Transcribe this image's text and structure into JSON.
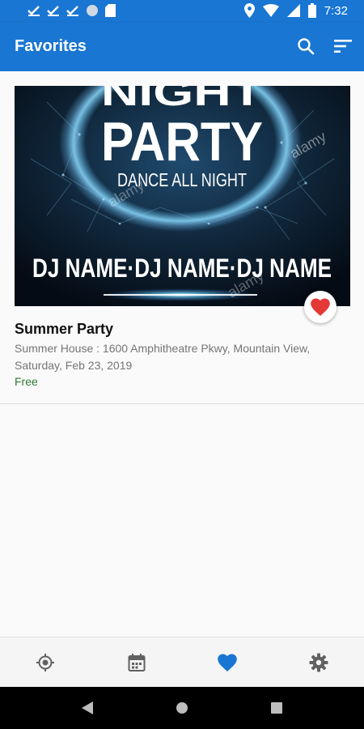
{
  "status_bar": {
    "time": "7:32",
    "icons": [
      "check-icon",
      "check-icon",
      "check-icon",
      "circle-icon",
      "sd-card-icon",
      "location-icon",
      "wifi-icon",
      "signal-icon",
      "battery-icon"
    ]
  },
  "app_bar": {
    "title": "Favorites",
    "actions": [
      "search-icon",
      "sort-icon"
    ]
  },
  "event": {
    "poster": {
      "headline_top": "NIGHT",
      "headline": "PARTY",
      "tagline": "DANCE ALL NIGHT",
      "lineup": "DJ NAME·DJ NAME·DJ NAME",
      "watermark": "alamy"
    },
    "title": "Summer Party",
    "location": "Summer House : 1600 Amphitheatre Pkwy, Mountain View,",
    "date": "Saturday, Feb 23, 2019",
    "price": "Free",
    "favorited": true
  },
  "bottom_nav": {
    "items": [
      "location-target-icon",
      "calendar-icon",
      "heart-icon",
      "settings-icon"
    ],
    "active_index": 2
  },
  "colors": {
    "primary": "#1976d2",
    "heart": "#e53935",
    "price": "#2e7d32",
    "nav_inactive": "#616161"
  }
}
